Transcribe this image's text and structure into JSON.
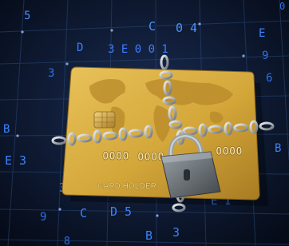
{
  "scene": {
    "description_tag": "locked-credit-card",
    "background_color": "#0a1428",
    "grid_color": "#2a4a7a",
    "digit_color": "#3a82ff",
    "card_color": "#d4a73a",
    "card_shade": "#b8862a",
    "map_color": "#b88a2a",
    "chain_color": "#b9c1c8",
    "lock_color": "#6f767c"
  },
  "card": {
    "number_group_1": "0000",
    "number_group_2": "0000",
    "number_group_3": "0000",
    "holder_label": "CARD HOLDER"
  },
  "digits": [
    {
      "text": "5"
    },
    {
      "text": "C"
    },
    {
      "text": "0 4"
    },
    {
      "text": "D"
    },
    {
      "text": "3 E 0 0 1"
    },
    {
      "text": "E"
    },
    {
      "text": "3"
    },
    {
      "text": "9"
    },
    {
      "text": "6"
    },
    {
      "text": "B"
    },
    {
      "text": "E 3"
    },
    {
      "text": "B"
    },
    {
      "text": "3 0"
    },
    {
      "text": "9"
    },
    {
      "text": "C"
    },
    {
      "text": "D 5"
    },
    {
      "text": "B"
    },
    {
      "text": "3"
    },
    {
      "text": "E 1"
    },
    {
      "text": "8"
    },
    {
      "text": "0"
    }
  ]
}
